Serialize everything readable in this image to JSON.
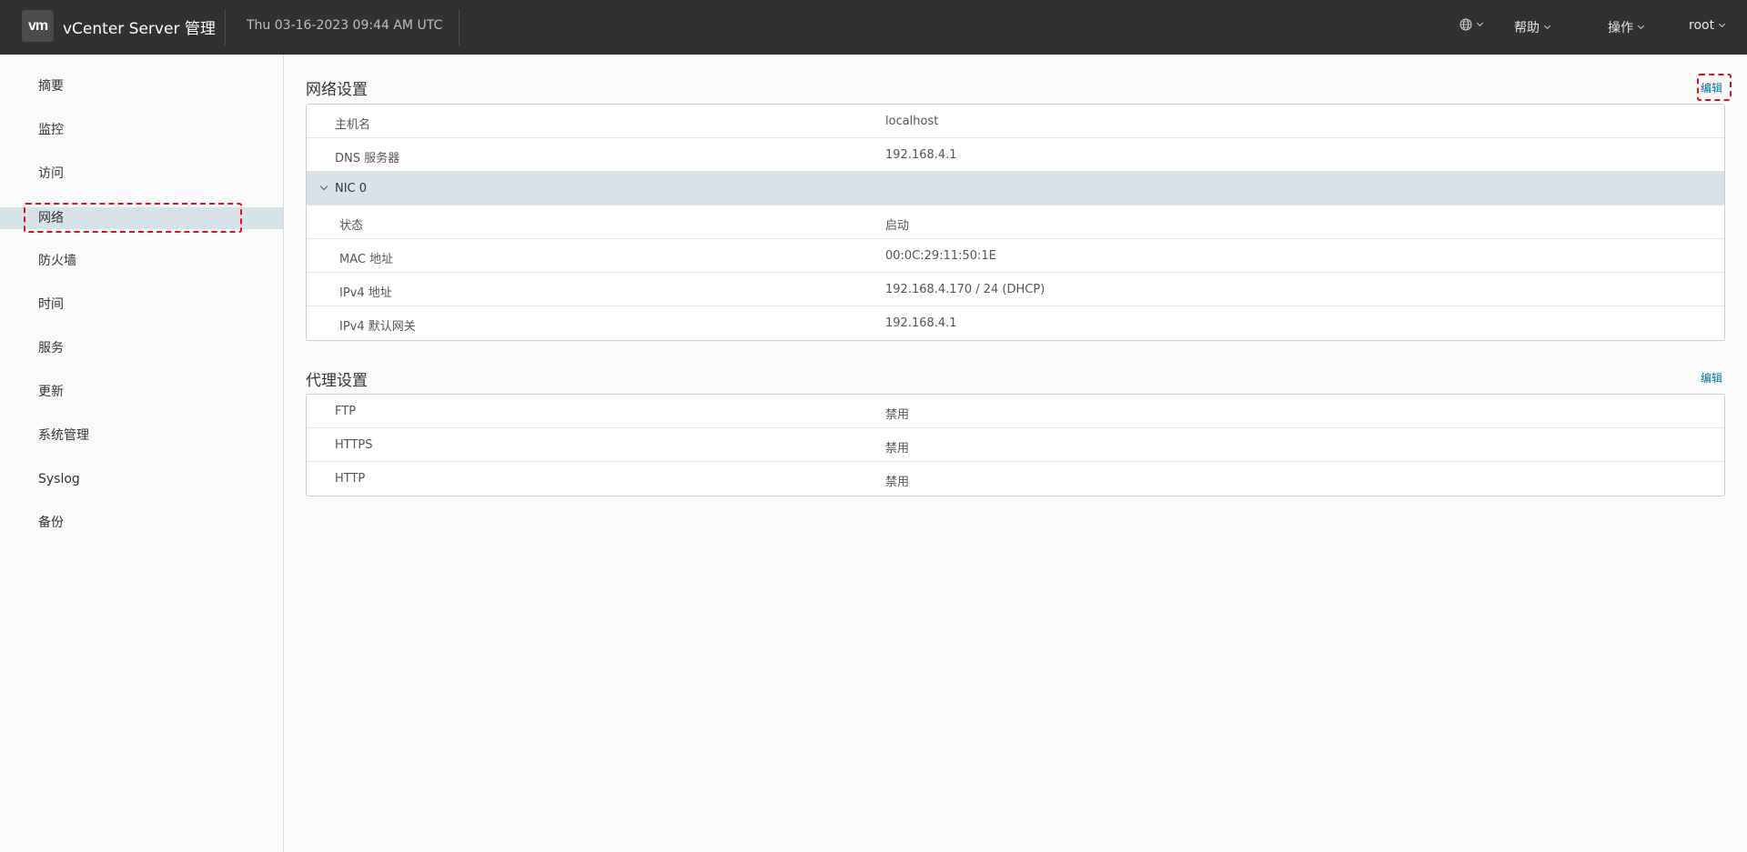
{
  "header": {
    "logo_text": "vm",
    "app_title": "vCenter Server 管理",
    "datetime": "Thu 03-16-2023 09:44 AM UTC",
    "menus": {
      "language_icon": "globe-icon",
      "help": "帮助",
      "actions": "操作",
      "user": "root"
    }
  },
  "sidebar": {
    "items": [
      {
        "label": "摘要"
      },
      {
        "label": "监控"
      },
      {
        "label": "访问"
      },
      {
        "label": "网络",
        "active": true
      },
      {
        "label": "防火墙"
      },
      {
        "label": "时间"
      },
      {
        "label": "服务"
      },
      {
        "label": "更新"
      },
      {
        "label": "系统管理"
      },
      {
        "label": "Syslog"
      },
      {
        "label": "备份"
      }
    ]
  },
  "network": {
    "title": "网络设置",
    "edit_label": "编辑",
    "rows": [
      {
        "key": "主机名",
        "value": "localhost"
      },
      {
        "key": "DNS 服务器",
        "value": "192.168.4.1"
      }
    ],
    "nic": {
      "label": "NIC 0",
      "expanded": true,
      "rows": [
        {
          "key": "状态",
          "value": "启动"
        },
        {
          "key": "MAC 地址",
          "value": "00:0C:29:11:50:1E"
        },
        {
          "key": "IPv4 地址",
          "value": "192.168.4.170 / 24 (DHCP)"
        },
        {
          "key": "IPv4 默认网关",
          "value": "192.168.4.1"
        }
      ]
    }
  },
  "proxy": {
    "title": "代理设置",
    "edit_label": "编辑",
    "rows": [
      {
        "key": "FTP",
        "value": "禁用"
      },
      {
        "key": "HTTPS",
        "value": "禁用"
      },
      {
        "key": "HTTP",
        "value": "禁用"
      }
    ]
  },
  "colors": {
    "header_bg": "#313131",
    "active_bg": "#d8e3e9",
    "link": "#0072a3",
    "highlight": "#e0101c"
  }
}
